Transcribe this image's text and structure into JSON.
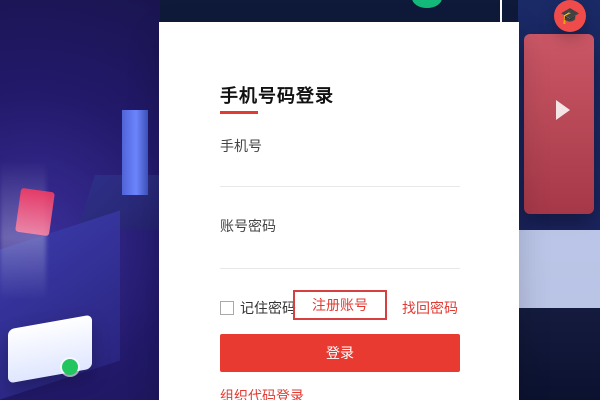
{
  "login": {
    "title": "手机号码登录",
    "phone_label": "手机号",
    "phone_value": "",
    "password_label": "账号密码",
    "password_value": "",
    "remember_label": "记住密码",
    "register_link": "注册账号",
    "recover_link": "找回密码",
    "submit_label": "登录",
    "org_login_link": "组织代码登录"
  },
  "colors": {
    "accent_red": "#e93a32",
    "link_red": "#e23b33",
    "bg_dark_blue": "#1b1f6b"
  },
  "icons": {
    "graduation_icon": "graduation-cap-icon",
    "play_icon": "play-icon",
    "check_icon": "check-icon"
  }
}
